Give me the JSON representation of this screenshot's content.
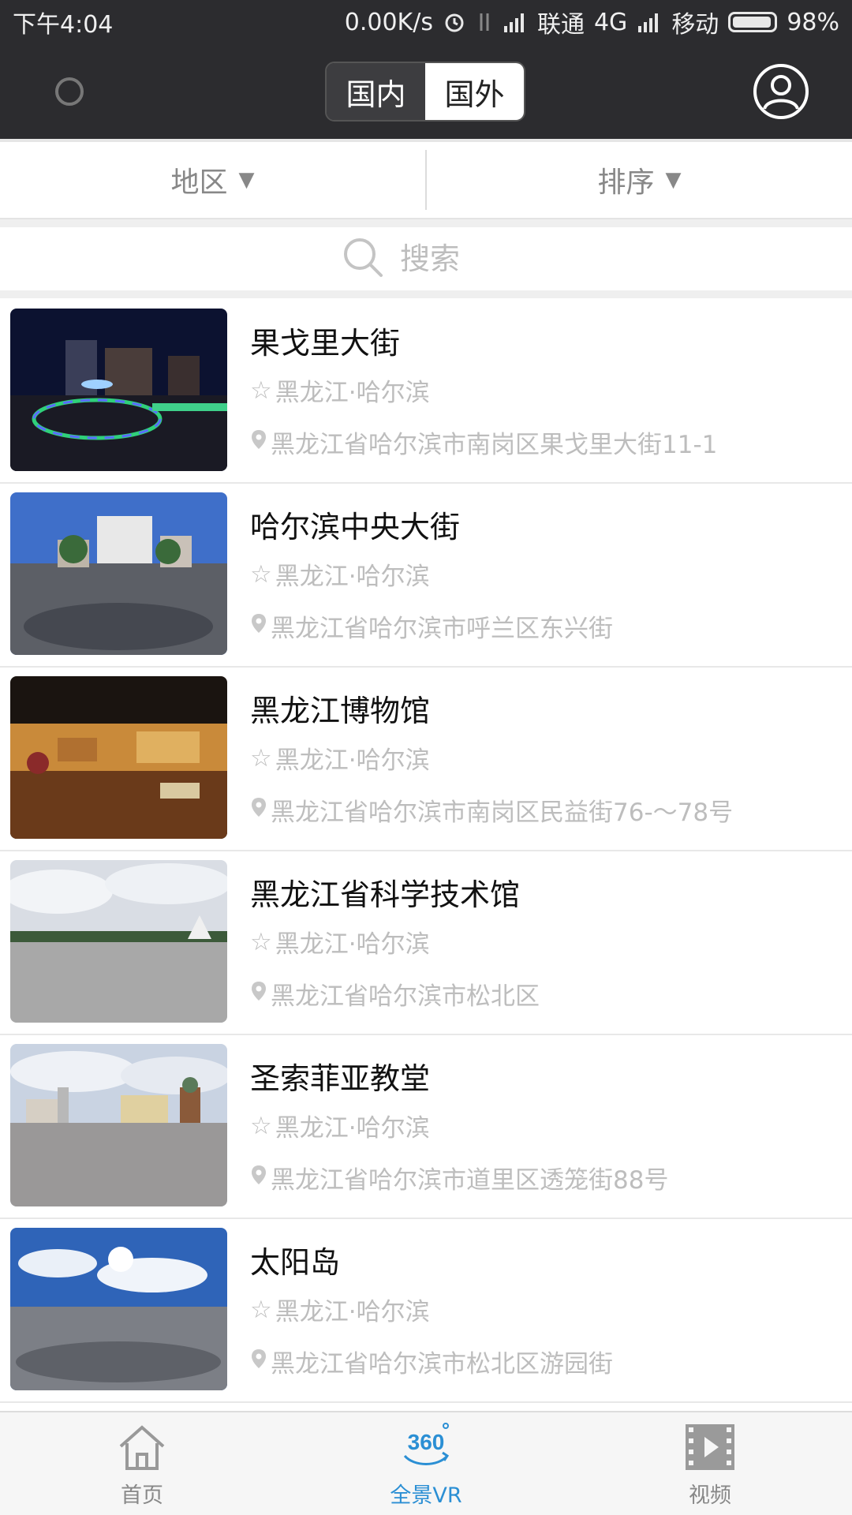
{
  "status_bar": {
    "time": "下午4:04",
    "speed": "0.00K/s",
    "carrier1": "联通",
    "network": "4G",
    "carrier2": "移动",
    "battery": "98%"
  },
  "header": {
    "tabs": [
      {
        "label": "国内",
        "active": false
      },
      {
        "label": "国外",
        "active": true
      }
    ]
  },
  "filters": {
    "region_label": "地区",
    "sort_label": "排序"
  },
  "search": {
    "placeholder": "搜索"
  },
  "list": [
    {
      "title": "果戈里大街",
      "region": "黑龙江·哈尔滨",
      "address": "黑龙江省哈尔滨市南岗区果戈里大街11-1",
      "thumb": "night"
    },
    {
      "title": "哈尔滨中央大街",
      "region": "黑龙江·哈尔滨",
      "address": "黑龙江省哈尔滨市呼兰区东兴街",
      "thumb": "street"
    },
    {
      "title": "黑龙江博物馆",
      "region": "黑龙江·哈尔滨",
      "address": "黑龙江省哈尔滨市南岗区民益街76-～78号",
      "thumb": "museum"
    },
    {
      "title": "黑龙江省科学技术馆",
      "region": "黑龙江·哈尔滨",
      "address": "黑龙江省哈尔滨市松北区",
      "thumb": "cloudy"
    },
    {
      "title": "圣索菲亚教堂",
      "region": "黑龙江·哈尔滨",
      "address": "黑龙江省哈尔滨市道里区透笼街88号",
      "thumb": "plaza"
    },
    {
      "title": "太阳岛",
      "region": "黑龙江·哈尔滨",
      "address": "黑龙江省哈尔滨市松北区游园街",
      "thumb": "sunny"
    }
  ],
  "bottom_nav": [
    {
      "label": "首页",
      "icon": "home-icon",
      "active": false
    },
    {
      "label": "全景VR",
      "icon": "panorama-360-icon",
      "badge": "360",
      "active": true
    },
    {
      "label": "视频",
      "icon": "film-icon",
      "active": false
    }
  ],
  "colors": {
    "header_bg": "#2c2c2f",
    "accent": "#2b8fd4",
    "muted_text": "#bdbdbd"
  }
}
